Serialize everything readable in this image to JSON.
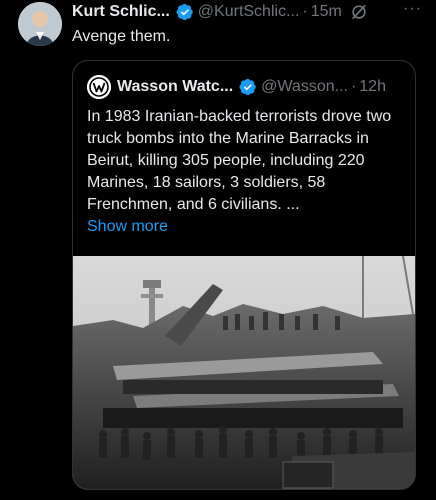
{
  "tweet": {
    "author_name": "Kurt Schlic...",
    "author_handle": "@KurtSchlic...",
    "separator": "·",
    "time": "15m",
    "more": "···",
    "text": "Avenge them."
  },
  "quote": {
    "author_name": "Wasson Watc...",
    "author_handle": "@Wasson...",
    "separator": "·",
    "time": "12h",
    "text": "In 1983 Iranian-backed terrorists drove two truck bombs into the Marine Barracks in Beirut, killing 305 people, including 220 Marines, 18 sailors, 3 soldiers, 58 Frenchmen, and 6 civilians. ...",
    "show_more": "Show more"
  },
  "icons": {
    "verified": "verified-badge-icon",
    "grok": "grok-icon",
    "more": "more-options-icon"
  },
  "colors": {
    "background": "#000000",
    "text": "#e7e9ea",
    "secondary": "#71767b",
    "link": "#1d9bf0",
    "border": "#2f3336"
  }
}
